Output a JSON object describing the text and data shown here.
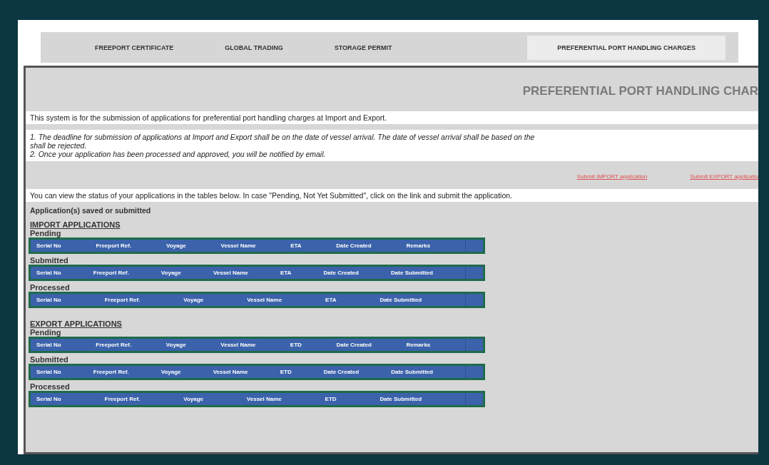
{
  "tabs": [
    {
      "label": "FREEPORT CERTIFICATE",
      "selected": false
    },
    {
      "label": "GLOBAL TRADING",
      "selected": false
    },
    {
      "label": "STORAGE PERMIT",
      "selected": false
    },
    {
      "label": "PREFERENTIAL PORT HANDLING CHARGES",
      "selected": true
    }
  ],
  "panel": {
    "title": "PREFERENTIAL PORT HANDLING CHAR",
    "intro": "This system is for the submission of applications for preferential port handling charges at Import and Export.",
    "notes": [
      "1. The deadline for submission of applications at Import and Export shall be on the date of vessel arrival. The date of vessel arrival shall be based on the",
      "shall be rejected.",
      "2. Once your application has been processed and approved, you will be notified by email."
    ],
    "links": [
      "Submit IMPORT application",
      "Submit EXPORT applicatio"
    ],
    "status_text": "You can view the status of your applications in the tables below. In case \"Pending, Not Yet Submitted\", click on the link and submit the application.",
    "saved_label": "Application(s) saved or submitted",
    "sections": [
      {
        "heading": "IMPORT APPLICATIONS",
        "groups": [
          {
            "label": "Pending",
            "columns": [
              "Serial No",
              "Freeport Ref.",
              "Voyage",
              "Vessel Name",
              "ETA",
              "Date Created",
              "Remarks"
            ]
          },
          {
            "label": "Submitted",
            "columns": [
              "Serial No",
              "Freeport Ref.",
              "Voyage",
              "Vessel Name",
              "ETA",
              "Date Created",
              "Date Submitted"
            ]
          },
          {
            "label": "Processed",
            "columns": [
              "Serial No",
              "Freeport Ref.",
              "Voyage",
              "Vessel Name",
              "ETA",
              "Date Submitted"
            ]
          }
        ]
      },
      {
        "heading": "EXPORT APPLICATIONS",
        "groups": [
          {
            "label": "Pending",
            "columns": [
              "Serial No",
              "Freeport Ref.",
              "Voyage",
              "Vessel Name",
              "ETD",
              "Date Created",
              "Remarks"
            ]
          },
          {
            "label": "Submitted",
            "columns": [
              "Serial No",
              "Freeport Ref.",
              "Voyage",
              "Vessel Name",
              "ETD",
              "Date Created",
              "Date Submitted"
            ]
          },
          {
            "label": "Processed",
            "columns": [
              "Serial No",
              "Freeport Ref.",
              "Voyage",
              "Vessel Name",
              "ETD",
              "Date Submitted"
            ]
          }
        ]
      }
    ]
  }
}
